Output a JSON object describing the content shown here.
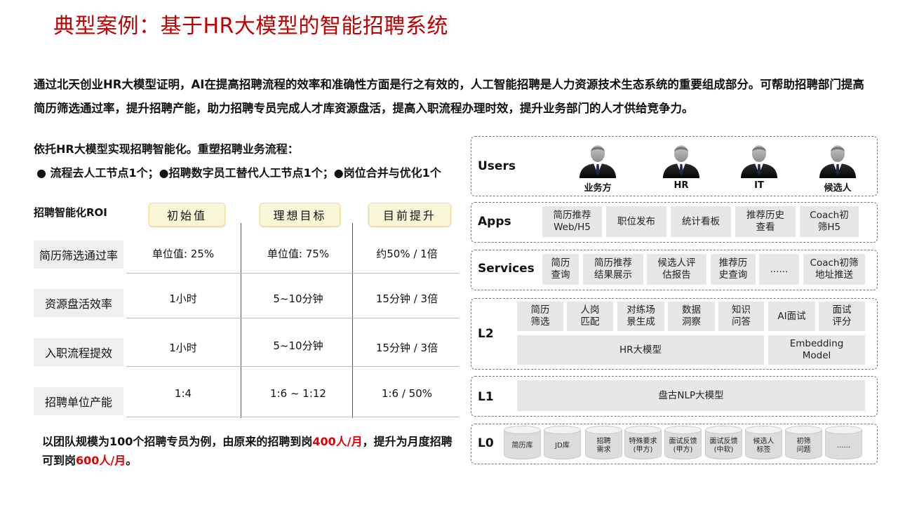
{
  "title": "典型案例：基于HR大模型的智能招聘系统",
  "intro": "通过北天创业HR大模型证明，AI在提高招聘流程的效率和准确性方面是行之有效的，人工智能招聘是人力资源技术生态系统的重要组成部分。可帮助招聘部门提高简历筛选通过率，提升招聘产能，助力招聘专员完成人才库资源盘活，提高入职流程办理时效，提升业务部门的人才供给竞争力。",
  "subhead": "依托HR大模型实现招聘智能化。重塑招聘业务流程：",
  "bullets": "● 流程去人工节点1个；●招聘数字员工替代人工节点1个；●岗位合并与优化1个",
  "roi": {
    "label": "招聘智能化ROI",
    "headers": [
      "初始值",
      "理想目标",
      "目前提升"
    ],
    "rows": [
      {
        "label": "简历筛选通过率",
        "values": [
          "单位值: 25%",
          "单位值: 75%",
          "约50% / 1倍"
        ]
      },
      {
        "label": "资源盘活效率",
        "values": [
          "1小时",
          "5~10分钟",
          "15分钟 / 3倍"
        ]
      },
      {
        "label": "入职流程提效",
        "values": [
          "1小时",
          "5~10分钟",
          "15分钟 / 3倍"
        ]
      },
      {
        "label": "招聘单位产能",
        "values": [
          "1:4",
          "1:6 ~ 1:12",
          "1:6 / 50%"
        ]
      }
    ]
  },
  "conclusion": {
    "p1": "以团队规模为100个招聘专员为例，由原来的招聘到岗",
    "h1": "400人/月",
    "p2": "，提升为月度招聘可到岗",
    "h2": "600人/月",
    "p3": "。"
  },
  "arch": {
    "users": {
      "label": "Users",
      "people": [
        "业务方",
        "HR",
        "IT",
        "候选人"
      ]
    },
    "apps": {
      "label": "Apps",
      "items": [
        "简历推荐\nWeb/H5",
        "职位发布",
        "统计看板",
        "推荐历史\n查看",
        "Coach初\n筛H5"
      ]
    },
    "services": {
      "label": "Services",
      "items": [
        "简历\n查询",
        "简历推荐\n结果展示",
        "候选人评\n估报告",
        "推荐历\n史查询",
        "......",
        "Coach初筛\n地址推送"
      ]
    },
    "l2": {
      "label": "L2",
      "items": [
        "简历\n筛选",
        "人岗\n匹配",
        "对练场\n景生成",
        "数据\n洞察",
        "知识\n问答",
        "AI面试",
        "面试\n评分"
      ],
      "model": "HR大模型",
      "embedding": "Embedding\nModel"
    },
    "l1": {
      "label": "L1",
      "model": "盘古NLP大模型"
    },
    "l0": {
      "label": "L0",
      "items": [
        "简历库",
        "JD库",
        "招聘\n需求",
        "特殊要求\n(甲方)",
        "面试反馈\n(甲方)",
        "面试反馈\n(中软)",
        "候选人\n标签",
        "初筛\n问题",
        "......"
      ]
    }
  }
}
